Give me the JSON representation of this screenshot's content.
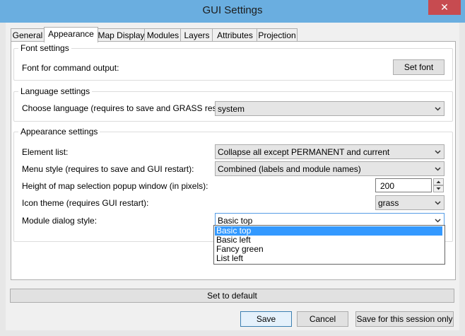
{
  "window": {
    "title": "GUI Settings",
    "close_glyph": "✕"
  },
  "tabs": [
    {
      "label": "General"
    },
    {
      "label": "Appearance"
    },
    {
      "label": "Map Display"
    },
    {
      "label": "Modules"
    },
    {
      "label": "Layers"
    },
    {
      "label": "Attributes"
    },
    {
      "label": "Projection"
    }
  ],
  "font_settings": {
    "title": "Font settings",
    "cmd_label": "Font for command output:",
    "set_font_button": "Set font"
  },
  "language_settings": {
    "title": "Language settings",
    "label": "Choose language (requires to save and GRASS restart):",
    "value": "system"
  },
  "appearance_settings": {
    "title": "Appearance settings",
    "element_list_label": "Element list:",
    "element_list_value": "Collapse all except PERMANENT and current",
    "menu_style_label": "Menu style (requires to save and GUI restart):",
    "menu_style_value": "Combined (labels and module names)",
    "popup_height_label": "Height of map selection popup window (in pixels):",
    "popup_height_value": "200",
    "icon_theme_label": "Icon theme (requires GUI restart):",
    "icon_theme_value": "grass",
    "dialog_style_label": "Module dialog style:",
    "dialog_style_value": "Basic top",
    "dialog_style_options": [
      "Basic top",
      "Basic left",
      "Fancy green",
      "List left"
    ]
  },
  "footer": {
    "default_button": "Set to default",
    "save_button": "Save",
    "cancel_button": "Cancel",
    "session_button": "Save for this session only"
  },
  "colors": {
    "titlebar": "#6aaee0",
    "close": "#c74b50",
    "selection": "#3399ff",
    "focus_border": "#569de5"
  }
}
